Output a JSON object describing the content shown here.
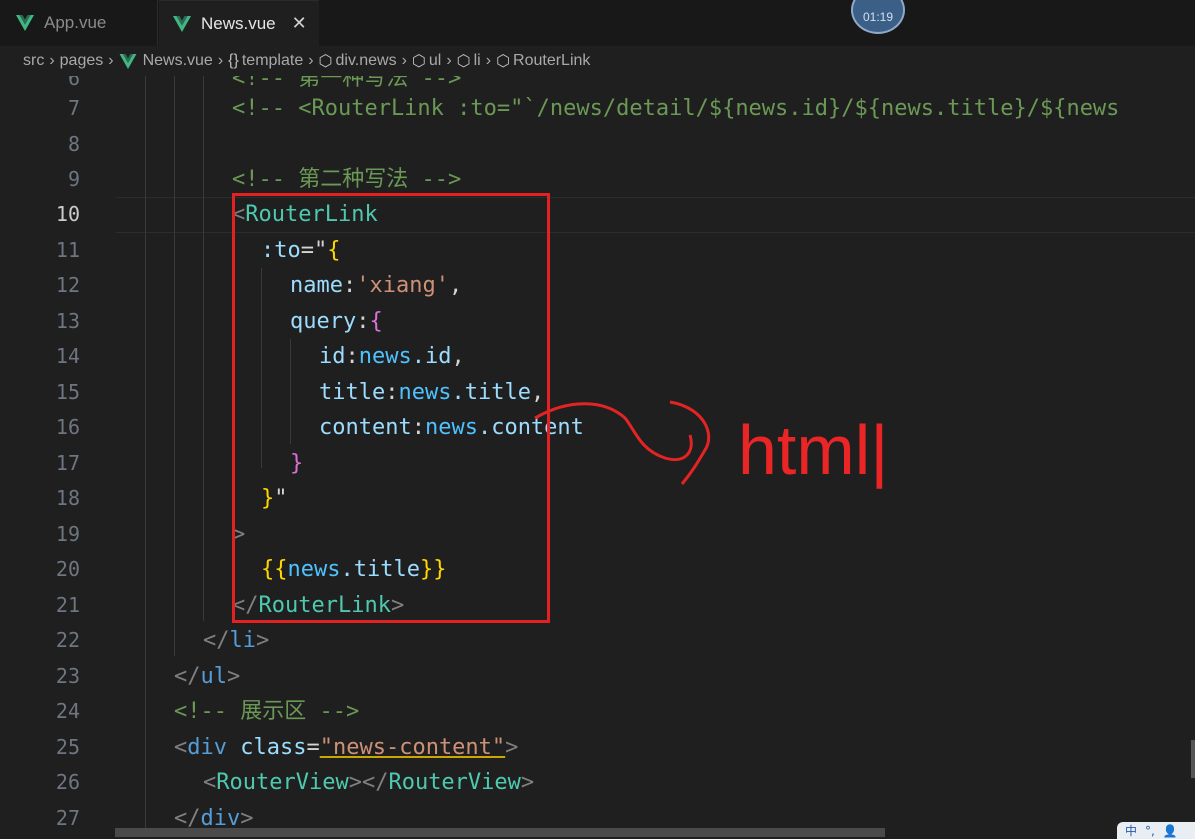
{
  "tabs": [
    {
      "label": "App.vue",
      "icon": "vue-icon",
      "active": false
    },
    {
      "label": "News.vue",
      "icon": "vue-icon",
      "active": true,
      "close": "✕"
    }
  ],
  "timer": "01:19",
  "breadcrumb": [
    "src",
    "pages",
    "News.vue",
    "template",
    "div.news",
    "ul",
    "li",
    "RouterLink"
  ],
  "line_numbers": [
    "6",
    "7",
    "8",
    "9",
    "10",
    "11",
    "12",
    "13",
    "14",
    "15",
    "16",
    "17",
    "18",
    "19",
    "20",
    "21",
    "22",
    "23",
    "24",
    "25",
    "26",
    "27"
  ],
  "active_line": "10",
  "code": {
    "l6": "<!-- 第一种写法 -->",
    "l7": "<!-- <RouterLink :to=\"`/news/detail/${news.id}/${news.title}/${news",
    "l9": "<!-- 第二种写法 -->",
    "l10_open": "<",
    "l10_tag": "RouterLink",
    "l11_attr": ":to",
    "l11_eq": "=\"",
    "l11_brace": "{",
    "l12_key": "name",
    "l12_colon": ":",
    "l12_val": "'xiang'",
    "l12_comma": ",",
    "l13_key": "query",
    "l13_colon": ":",
    "l13_brace": "{",
    "l14_key": "id",
    "l14_obj": "news",
    "l14_prop": ".id",
    "l14_comma": ",",
    "l15_key": "title",
    "l15_obj": "news",
    "l15_prop": ".title",
    "l15_comma": ",",
    "l16_key": "content",
    "l16_obj": "news",
    "l16_prop": ".content",
    "l17_brace": "}",
    "l18_brace": "}",
    "l18_quote": "\"",
    "l19": ">",
    "l20_open": "{{",
    "l20_obj": "news",
    "l20_prop": ".title",
    "l20_close": "}}",
    "l21_open": "</",
    "l21_tag": "RouterLink",
    "l21_close": ">",
    "l22_open": "</",
    "l22_tag": "li",
    "l22_close": ">",
    "l23_open": "</",
    "l23_tag": "ul",
    "l23_close": ">",
    "l24": "<!-- 展示区 -->",
    "l25_open": "<",
    "l25_tag": "div",
    "l25_attr": " class",
    "l25_eq": "=",
    "l25_val": "\"news-content\"",
    "l25_close": ">",
    "l26_open": "<",
    "l26_tag": "RouterView",
    "l26_mid": "></",
    "l26_tag2": "RouterView",
    "l26_close": ">",
    "l27_open": "</",
    "l27_tag": "div",
    "l27_close": ">"
  },
  "annotation": {
    "text": "html|",
    "color": "#ea2525"
  },
  "ime": {
    "lang": "中",
    "symbol": "°,",
    "user": "👤"
  }
}
